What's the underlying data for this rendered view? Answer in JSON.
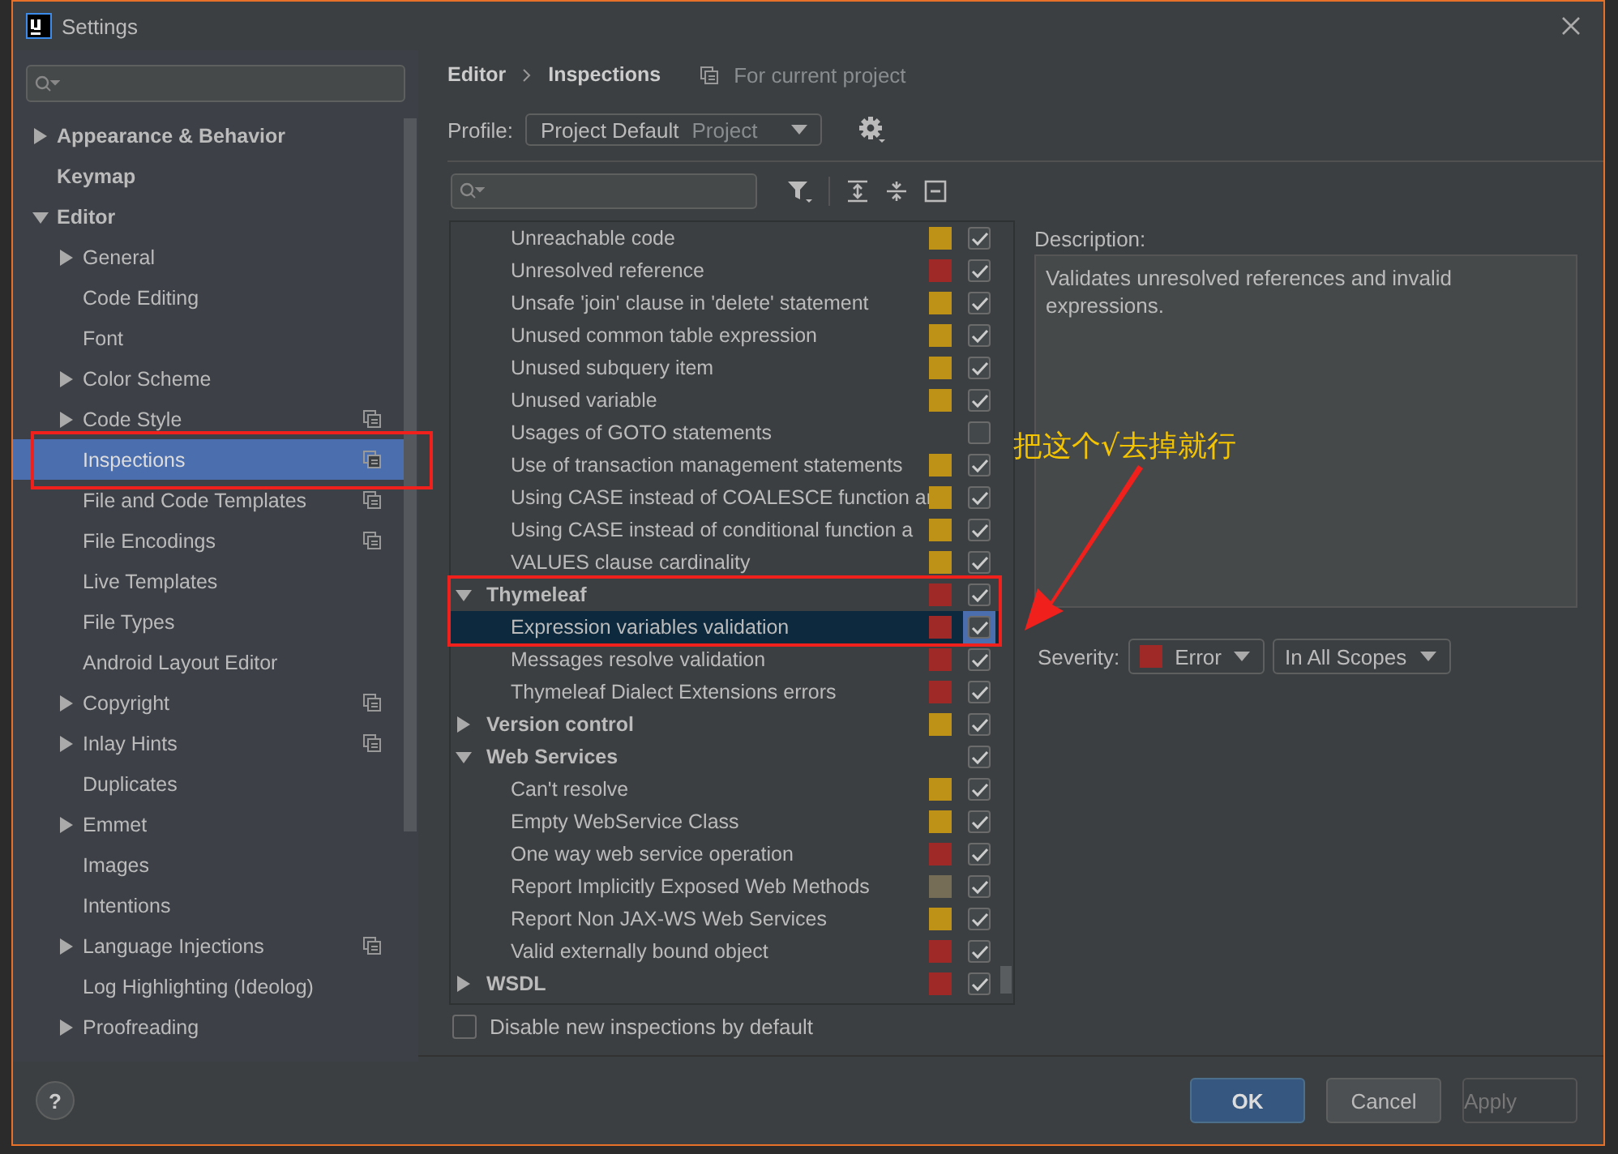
{
  "window": {
    "title": "Settings"
  },
  "sidebar": {
    "items": [
      {
        "label": "Appearance & Behavior",
        "expanded": false,
        "selected": false
      },
      {
        "label": "Keymap",
        "selected": false
      },
      {
        "label": "Editor",
        "expanded": true,
        "selected": false,
        "children": [
          {
            "label": "General",
            "expanded": false,
            "project_scoped": false,
            "selected": false
          },
          {
            "label": "Code Editing",
            "project_scoped": false,
            "selected": false
          },
          {
            "label": "Font",
            "project_scoped": false,
            "selected": false
          },
          {
            "label": "Color Scheme",
            "expanded": false,
            "project_scoped": false,
            "selected": false
          },
          {
            "label": "Code Style",
            "expanded": false,
            "project_scoped": true,
            "selected": false
          },
          {
            "label": "Inspections",
            "project_scoped": true,
            "selected": true
          },
          {
            "label": "File and Code Templates",
            "project_scoped": true,
            "selected": false
          },
          {
            "label": "File Encodings",
            "project_scoped": true,
            "selected": false
          },
          {
            "label": "Live Templates",
            "project_scoped": false,
            "selected": false
          },
          {
            "label": "File Types",
            "project_scoped": false,
            "selected": false
          },
          {
            "label": "Android Layout Editor",
            "project_scoped": false,
            "selected": false
          },
          {
            "label": "Copyright",
            "expanded": false,
            "project_scoped": true,
            "selected": false
          },
          {
            "label": "Inlay Hints",
            "expanded": false,
            "project_scoped": true,
            "selected": false
          },
          {
            "label": "Duplicates",
            "project_scoped": false,
            "selected": false
          },
          {
            "label": "Emmet",
            "expanded": false,
            "project_scoped": false,
            "selected": false
          },
          {
            "label": "Images",
            "project_scoped": false,
            "selected": false
          },
          {
            "label": "Intentions",
            "project_scoped": false,
            "selected": false
          },
          {
            "label": "Language Injections",
            "expanded": false,
            "project_scoped": true,
            "selected": false
          },
          {
            "label": "Log Highlighting (Ideolog)",
            "project_scoped": false,
            "selected": false
          },
          {
            "label": "Proofreading",
            "expanded": false,
            "project_scoped": false,
            "selected": false
          }
        ]
      }
    ]
  },
  "breadcrumb": {
    "items": [
      "Editor",
      "Inspections"
    ],
    "scope": "For current project"
  },
  "profile": {
    "label": "Profile:",
    "value": "Project Default",
    "suffix": "Project"
  },
  "inspections": {
    "items_of_previous_group": [
      {
        "label": "Unreachable code",
        "color": "#be9117",
        "checked": true,
        "selected": false
      },
      {
        "label": "Unresolved reference",
        "color": "#9e2927",
        "checked": true,
        "selected": false
      },
      {
        "label": "Unsafe 'join' clause in 'delete' statement",
        "color": "#be9117",
        "checked": true,
        "selected": false
      },
      {
        "label": "Unused common table expression",
        "color": "#be9117",
        "checked": true,
        "selected": false
      },
      {
        "label": "Unused subquery item",
        "color": "#be9117",
        "checked": true,
        "selected": false
      },
      {
        "label": "Unused variable",
        "color": "#be9117",
        "checked": true,
        "selected": false
      },
      {
        "label": "Usages of GOTO statements",
        "checked": false,
        "selected": false
      },
      {
        "label": "Use of transaction management statements",
        "color": "#be9117",
        "checked": true,
        "selected": false
      },
      {
        "label": "Using CASE instead of COALESCE function ar",
        "color": "#be9117",
        "checked": true,
        "selected": false
      },
      {
        "label": "Using CASE instead of conditional function a",
        "color": "#be9117",
        "checked": true,
        "selected": false
      },
      {
        "label": "VALUES clause cardinality",
        "color": "#be9117",
        "checked": true,
        "selected": false
      }
    ],
    "groups": [
      {
        "label": "Thymeleaf",
        "expanded": true,
        "color": "#9e2927",
        "checked": true,
        "selected": false,
        "children": [
          {
            "label": "Expression variables validation",
            "color": "#9e2927",
            "checked": true,
            "selected": true
          },
          {
            "label": "Messages resolve validation",
            "color": "#9e2927",
            "checked": true,
            "selected": false
          },
          {
            "label": "Thymeleaf Dialect Extensions errors",
            "color": "#9e2927",
            "checked": true,
            "selected": false
          }
        ]
      },
      {
        "label": "Version control",
        "expanded": false,
        "color": "#be9117",
        "checked": true,
        "selected": false
      },
      {
        "label": "Web Services",
        "expanded": true,
        "checked": true,
        "selected": false,
        "children": [
          {
            "label": "Can't resolve",
            "color": "#be9117",
            "checked": true,
            "selected": false
          },
          {
            "label": "Empty WebService Class",
            "color": "#be9117",
            "checked": true,
            "selected": false
          },
          {
            "label": "One way web service operation",
            "color": "#9e2927",
            "checked": true,
            "selected": false
          },
          {
            "label": "Report Implicitly Exposed Web Methods",
            "color": "#756d56",
            "checked": true,
            "selected": false
          },
          {
            "label": "Report Non JAX-WS Web Services",
            "color": "#be9117",
            "checked": true,
            "selected": false
          },
          {
            "label": "Valid externally bound object",
            "color": "#9e2927",
            "checked": true,
            "selected": false
          }
        ]
      },
      {
        "label": "WSDL",
        "expanded": false,
        "color": "#9e2927",
        "checked": true,
        "selected": false
      }
    ]
  },
  "disable_new": {
    "label": "Disable new inspections by default",
    "checked": false
  },
  "description": {
    "label": "Description:",
    "text": "Validates unresolved references and invalid expressions."
  },
  "severity": {
    "label": "Severity:",
    "value": "Error",
    "color": "#9e2927",
    "scope": "In All Scopes"
  },
  "help": {
    "label": "?"
  },
  "buttons": [
    {
      "label": "OK",
      "kind": "primary",
      "disabled": false
    },
    {
      "label": "Cancel",
      "kind": "normal",
      "disabled": false
    },
    {
      "label": "Apply",
      "kind": "normal",
      "disabled": true
    }
  ],
  "annotation": {
    "text": "把这个√去掉就行"
  }
}
